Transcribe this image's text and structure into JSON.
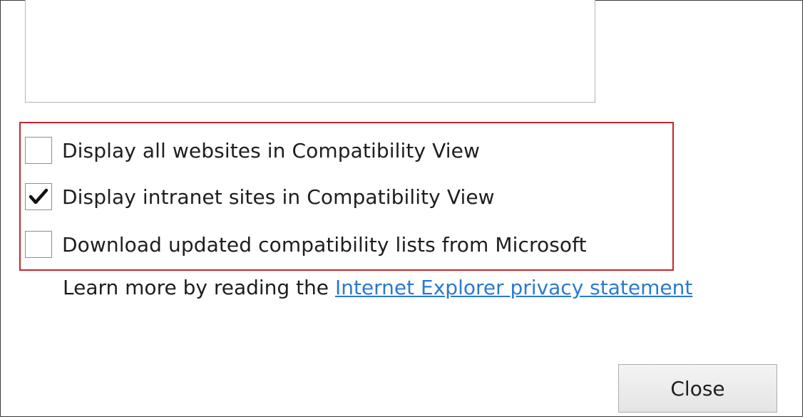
{
  "options": [
    {
      "label": "Display all websites in Compatibility View",
      "checked": false
    },
    {
      "label": "Display intranet sites in Compatibility View",
      "checked": true
    },
    {
      "label": "Download updated compatibility lists from Microsoft",
      "checked": false
    }
  ],
  "learn_more": {
    "prefix": "Learn more by reading the",
    "link": "Internet Explorer privacy statement"
  },
  "buttons": {
    "close": "Close"
  },
  "colors": {
    "highlight": "#c4262e",
    "link": "#2a7ad3"
  }
}
